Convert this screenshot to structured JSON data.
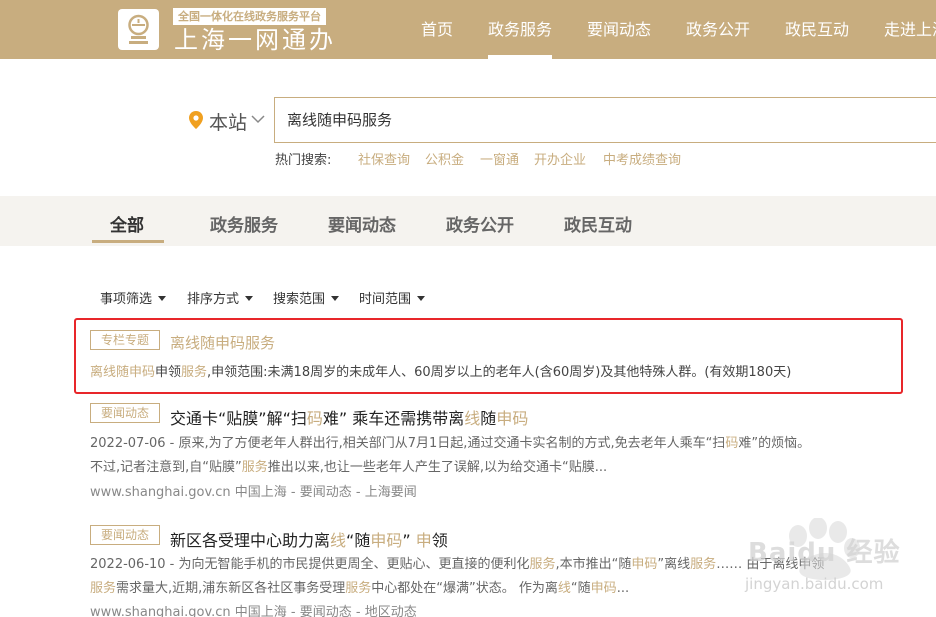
{
  "header": {
    "slogan": "全国一体化在线政务服务平台",
    "brand": "上海一网通办",
    "nav": [
      "首页",
      "政务服务",
      "要闻动态",
      "政务公开",
      "政民互动",
      "走进上海"
    ],
    "active_nav": "政务服务"
  },
  "search": {
    "scope": "本站",
    "query": "离线随申码服务",
    "hot_label": "热门搜索:",
    "hot_links": [
      "社保查询",
      "公积金",
      "一窗通",
      "开办企业",
      "中考成绩查询"
    ]
  },
  "tabs": [
    "全部",
    "政务服务",
    "要闻动态",
    "政务公开",
    "政民互动"
  ],
  "active_tab": "全部",
  "filters": [
    "事项筛选",
    "排序方式",
    "搜索范围",
    "时间范围"
  ],
  "results": [
    {
      "tag": "专栏专题",
      "title": "离线随申码服务",
      "desc": [
        {
          "t": "离线随申码",
          "h": true
        },
        {
          "t": "申领",
          "h": false
        },
        {
          "t": "服务",
          "h": true
        },
        {
          "t": ",申领范围:未满18周岁的未成年人、60周岁以上的老年人(含60周岁)及其他特殊人群。(有效期180天)",
          "h": false
        }
      ]
    },
    {
      "tag": "要闻动态",
      "title": [
        {
          "t": "交通卡“贴膜”解“扫",
          "h": false
        },
        {
          "t": "码",
          "h": true
        },
        {
          "t": "难” 乘车还需携带离",
          "h": false
        },
        {
          "t": "线",
          "h": true
        },
        {
          "t": "随",
          "h": false
        },
        {
          "t": "申码",
          "h": true
        }
      ],
      "line1": [
        {
          "t": "2022-07-06 - 原来,为了方便老年人群出行,相关部门从7月1日起,通过交通卡实名制的方式,免去老年人乘车“扫",
          "h": false
        },
        {
          "t": "码",
          "h": true
        },
        {
          "t": "难”的烦恼。",
          "h": false
        }
      ],
      "line2": [
        {
          "t": "不过,记者注意到,自“贴膜”",
          "h": false
        },
        {
          "t": "服务",
          "h": true
        },
        {
          "t": "推出以来,也让一些老年人产生了误解,以为给交通卡“贴膜...",
          "h": false
        }
      ],
      "source": "www.shanghai.gov.cn 中国上海 - 要闻动态 - 上海要闻"
    },
    {
      "tag": "要闻动态",
      "title": [
        {
          "t": "新区各受理中心助力离",
          "h": false
        },
        {
          "t": "线",
          "h": true
        },
        {
          "t": "“随",
          "h": false
        },
        {
          "t": "申码",
          "h": true
        },
        {
          "t": "” ",
          "h": false
        },
        {
          "t": "申",
          "h": true
        },
        {
          "t": "领",
          "h": false
        }
      ],
      "line1": [
        {
          "t": "2022-06-10 - 为向无智能手机的市民提供更周全、更贴心、更直接的便利化",
          "h": false
        },
        {
          "t": "服务",
          "h": true
        },
        {
          "t": ",本市推出“随",
          "h": false
        },
        {
          "t": "申码",
          "h": true
        },
        {
          "t": "”离线",
          "h": false
        },
        {
          "t": "服务",
          "h": true
        },
        {
          "t": "…… 由于离线申领",
          "h": false
        }
      ],
      "line2": [
        {
          "t": "服务",
          "h": true
        },
        {
          "t": "需求量大,近期,浦东新区各社区事务受理",
          "h": false
        },
        {
          "t": "服务",
          "h": true
        },
        {
          "t": "中心都处在“爆满”状态。 作为离",
          "h": false
        },
        {
          "t": "线",
          "h": true
        },
        {
          "t": "“随",
          "h": false
        },
        {
          "t": "申码",
          "h": true
        },
        {
          "t": "...",
          "h": false
        }
      ],
      "source": "www.shanghai.gov.cn 中国上海 - 要闻动态 - 地区动态"
    }
  ],
  "watermark": {
    "line1": "Baidu 经验",
    "line2": "jingyan.baidu.com"
  },
  "colors": {
    "brand": "#c8ad7f",
    "highlight_box": "#e8262a",
    "tabs_bg": "#f5f3ef"
  }
}
